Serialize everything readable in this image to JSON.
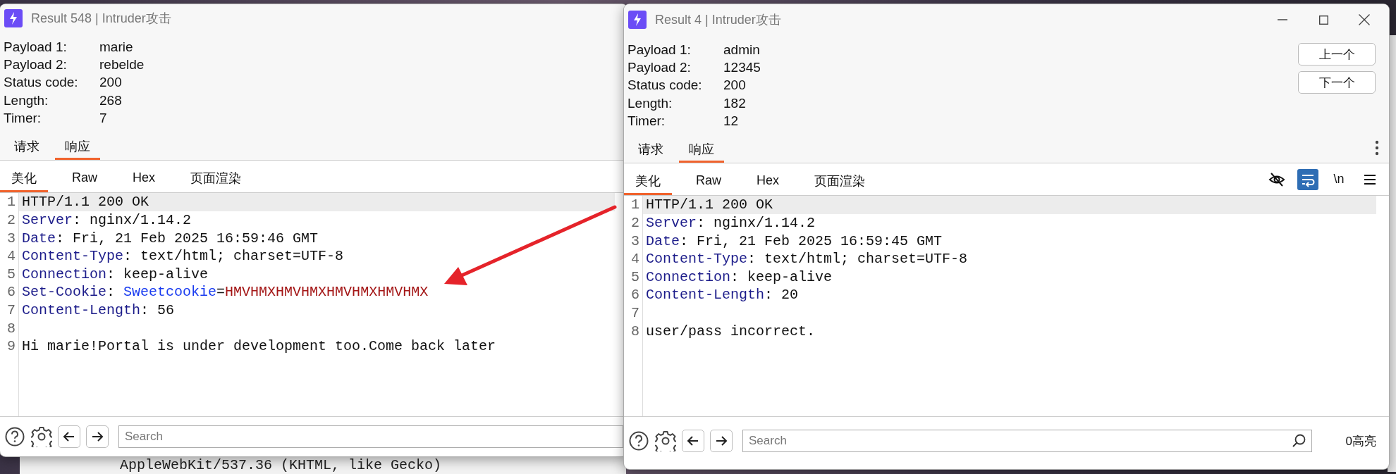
{
  "windows": [
    {
      "title": "Result 548 | Intruder攻击",
      "window_controls": false,
      "fields": [
        {
          "label": "Payload 1:",
          "value": "marie"
        },
        {
          "label": "Payload 2:",
          "value": "rebelde"
        },
        {
          "label": "Status code:",
          "value": "200"
        },
        {
          "label": "Length:",
          "value": "268"
        },
        {
          "label": "Timer:",
          "value": "7"
        }
      ],
      "tabs": [
        {
          "label": "请求",
          "selected": false
        },
        {
          "label": "响应",
          "selected": true
        }
      ],
      "tab_menu": false,
      "view_tabs": [
        {
          "label": "美化",
          "selected": true
        },
        {
          "label": "Raw",
          "selected": false
        },
        {
          "label": "Hex",
          "selected": false
        },
        {
          "label": "页面渲染",
          "selected": false
        }
      ],
      "lines": [
        {
          "number": "1",
          "highlighted": true,
          "parts": [
            {
              "text": "HTTP/1.1 200 OK",
              "kind": "plain"
            }
          ]
        },
        {
          "number": "2",
          "highlighted": false,
          "parts": [
            {
              "text": "Server",
              "kind": "key"
            },
            {
              "text": ": nginx/1.14.2",
              "kind": "plain"
            }
          ]
        },
        {
          "number": "3",
          "highlighted": false,
          "parts": [
            {
              "text": "Date",
              "kind": "key"
            },
            {
              "text": ": Fri, 21 Feb 2025 16:59:46 GMT",
              "kind": "plain"
            }
          ]
        },
        {
          "number": "4",
          "highlighted": false,
          "parts": [
            {
              "text": "Content-Type",
              "kind": "key"
            },
            {
              "text": ": text/html; charset=UTF-8",
              "kind": "plain"
            }
          ]
        },
        {
          "number": "5",
          "highlighted": false,
          "parts": [
            {
              "text": "Connection",
              "kind": "key"
            },
            {
              "text": ": keep-alive",
              "kind": "plain"
            }
          ]
        },
        {
          "number": "6",
          "highlighted": false,
          "parts": [
            {
              "text": "Set-Cookie",
              "kind": "key"
            },
            {
              "text": ": ",
              "kind": "plain"
            },
            {
              "text": "Sweetcookie",
              "kind": "cookie_name"
            },
            {
              "text": "=",
              "kind": "plain"
            },
            {
              "text": "HMVHMXHMVHMXHMVHMXHMVHMX",
              "kind": "cookie_value"
            }
          ]
        },
        {
          "number": "7",
          "highlighted": false,
          "parts": [
            {
              "text": "Content-Length",
              "kind": "key"
            },
            {
              "text": ": 56",
              "kind": "plain"
            }
          ]
        },
        {
          "number": "8",
          "highlighted": false
        },
        {
          "number": "9",
          "highlighted": false,
          "parts": [
            {
              "text": "Hi marie!Portal is under development too.Come back later",
              "kind": "plain"
            }
          ]
        }
      ],
      "search": {
        "placeholder": "Search"
      }
    },
    {
      "title": "Result 4 | Intruder攻击",
      "window_controls": true,
      "fields": [
        {
          "label": "Payload 1:",
          "value": "admin"
        },
        {
          "label": "Payload 2:",
          "value": "12345"
        },
        {
          "label": "Status code:",
          "value": "200"
        },
        {
          "label": "Length:",
          "value": "182"
        },
        {
          "label": "Timer:",
          "value": "12"
        }
      ],
      "nav_buttons": [
        "上一个",
        "下一个"
      ],
      "tabs": [
        {
          "label": "请求",
          "selected": false
        },
        {
          "label": "响应",
          "selected": true
        }
      ],
      "tab_menu": true,
      "view_tabs": [
        {
          "label": "美化",
          "selected": true
        },
        {
          "label": "Raw",
          "selected": false
        },
        {
          "label": "Hex",
          "selected": false
        },
        {
          "label": "页面渲染",
          "selected": false
        }
      ],
      "view_tools": [
        {
          "kind": "visibility",
          "selected": false
        },
        {
          "kind": "wrap",
          "selected": true
        },
        {
          "kind": "newline",
          "label": "\\n",
          "selected": false
        },
        {
          "kind": "menu",
          "selected": false
        }
      ],
      "lines": [
        {
          "number": "1",
          "highlighted": true,
          "parts": [
            {
              "text": "HTTP/1.1 200 OK",
              "kind": "plain"
            }
          ]
        },
        {
          "number": "2",
          "highlighted": false,
          "parts": [
            {
              "text": "Server",
              "kind": "key"
            },
            {
              "text": ": nginx/1.14.2",
              "kind": "plain"
            }
          ]
        },
        {
          "number": "3",
          "highlighted": false,
          "parts": [
            {
              "text": "Date",
              "kind": "key"
            },
            {
              "text": ": Fri, 21 Feb 2025 16:59:45 GMT",
              "kind": "plain"
            }
          ]
        },
        {
          "number": "4",
          "highlighted": false,
          "parts": [
            {
              "text": "Content-Type",
              "kind": "key"
            },
            {
              "text": ": text/html; charset=UTF-8",
              "kind": "plain"
            }
          ]
        },
        {
          "number": "5",
          "highlighted": false,
          "parts": [
            {
              "text": "Connection",
              "kind": "key"
            },
            {
              "text": ": keep-alive",
              "kind": "plain"
            }
          ]
        },
        {
          "number": "6",
          "highlighted": false,
          "parts": [
            {
              "text": "Content-Length",
              "kind": "key"
            },
            {
              "text": ": 20",
              "kind": "plain"
            }
          ]
        },
        {
          "number": "7",
          "highlighted": false
        },
        {
          "number": "8",
          "highlighted": false,
          "parts": [
            {
              "text": "user/pass incorrect.",
              "kind": "plain"
            }
          ]
        }
      ],
      "search": {
        "placeholder": "Search"
      },
      "highlight_count": "0高亮"
    }
  ],
  "background": {
    "text": "AppleWebKit/537.36 (KHTML, like Gecko)"
  }
}
